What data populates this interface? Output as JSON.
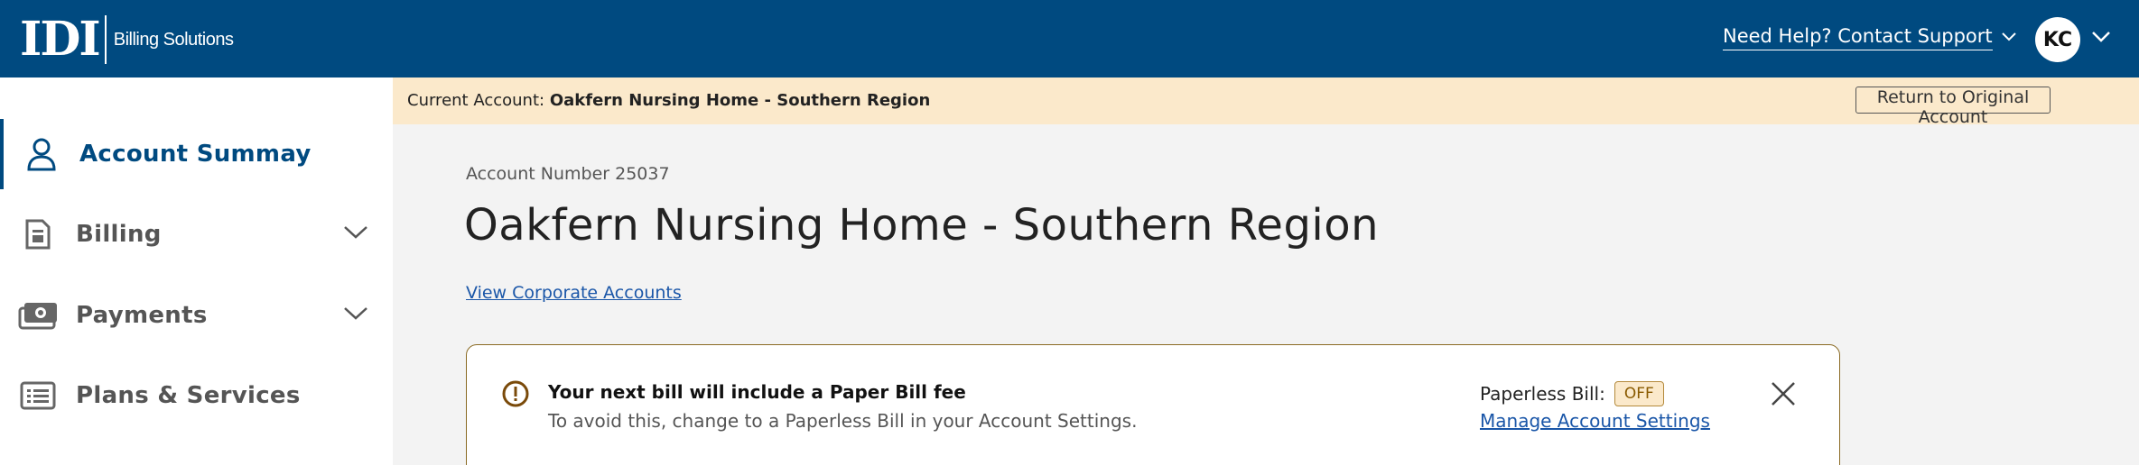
{
  "header": {
    "logo_mark": "IDI",
    "logo_text": "Billing Solutions",
    "help_label": "Need Help? Contact Support",
    "user_initials": "KC"
  },
  "sidebar": {
    "items": [
      {
        "label": "Account Summay",
        "icon": "user-icon",
        "active": true
      },
      {
        "label": "Billing",
        "icon": "bill-icon"
      },
      {
        "label": "Payments",
        "icon": "money-icon"
      },
      {
        "label": "Plans & Services",
        "icon": "list-icon"
      }
    ]
  },
  "account_banner": {
    "prefix": "Current Account:",
    "name": "Oakfern Nursing Home - Southern Region",
    "return_label": "Return to Original Account"
  },
  "main": {
    "account_number": "Account Number 25037",
    "account_name": "Oakfern Nursing Home - Southern Region",
    "corporate_link": "View Corporate Accounts"
  },
  "alert": {
    "title": "Your next bill will include a Paper Bill fee",
    "body": "To avoid this, change to a Paperless Bill in your Account Settings.",
    "paperless_label": "Paperless Bill:",
    "paperless_status": "OFF",
    "manage_link": "Manage Account Settings"
  },
  "colors": {
    "header_bg": "#004a80",
    "banner_bg": "#fbe9cb",
    "link": "#1a56a8",
    "alert_border": "#8a6a23"
  }
}
